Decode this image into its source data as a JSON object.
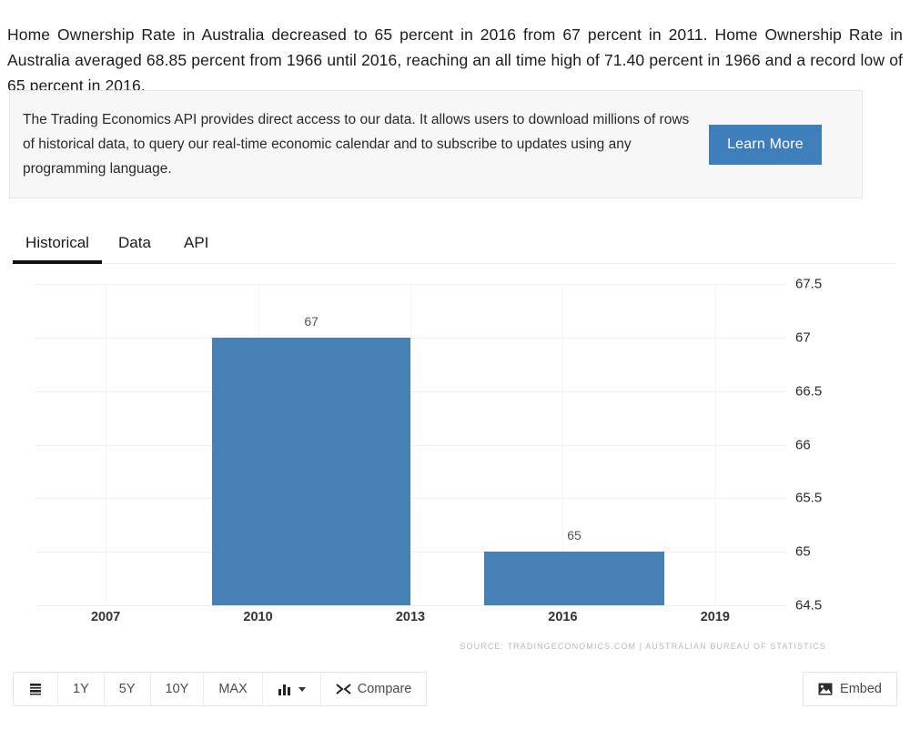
{
  "intro": {
    "text": "Home Ownership Rate in Australia decreased to 65 percent in 2016 from 67 percent in 2011. Home Ownership Rate in Australia averaged 68.85 percent from 1966 until 2016, reaching an all time high of 71.40 percent in 1966 and a record low of 65 percent in 2016."
  },
  "promo": {
    "text": "The Trading Economics API provides direct access to our data. It allows users to download millions of rows of historical data, to query our real-time economic calendar and to subscribe to updates using any programming language.",
    "button_label": "Learn More",
    "button_color": "#3d7ebb"
  },
  "tabs": [
    {
      "label": "Historical",
      "active": true
    },
    {
      "label": "Data",
      "active": false
    },
    {
      "label": "API",
      "active": false
    }
  ],
  "chart_data": {
    "type": "bar",
    "title": "",
    "xlabel": "",
    "ylabel": "",
    "categories": [
      "2011",
      "2016"
    ],
    "values": [
      67,
      65
    ],
    "data_labels": [
      "67",
      "65"
    ],
    "bar_color": "#4680b4",
    "bar_spans": [
      {
        "label": "67",
        "value": 67,
        "x_start": 2009.1,
        "x_end": 2013.0
      },
      {
        "label": "65",
        "value": 65,
        "x_start": 2014.45,
        "x_end": 2018.0
      }
    ],
    "xlim": [
      2005.6,
      2020.4
    ],
    "ylim": [
      64.5,
      67.5
    ],
    "yticks": [
      "67.5",
      "67",
      "66.5",
      "66",
      "65.5",
      "65",
      "64.5"
    ],
    "ytick_values": [
      67.5,
      67,
      66.5,
      66,
      65.5,
      65,
      64.5
    ],
    "xticks": [
      "2007",
      "2010",
      "2013",
      "2016",
      "2019"
    ],
    "xtick_values": [
      2007,
      2010,
      2013,
      2016,
      2019
    ],
    "grid": true,
    "legend": "none",
    "source": "SOURCE: TRADINGECONOMICS.COM  |  AUSTRALIAN BUREAU OF STATISTICS"
  },
  "toolbar": {
    "buttons": [
      {
        "name": "list-view",
        "label": "",
        "icon": "list-icon"
      },
      {
        "name": "range-1y",
        "label": "1Y",
        "icon": ""
      },
      {
        "name": "range-5y",
        "label": "5Y",
        "icon": ""
      },
      {
        "name": "range-10y",
        "label": "10Y",
        "icon": ""
      },
      {
        "name": "range-max",
        "label": "MAX",
        "icon": ""
      },
      {
        "name": "chart-type",
        "label": "",
        "icon": "bar-chart-icon"
      },
      {
        "name": "compare",
        "label": "Compare",
        "icon": "shuffle-icon"
      }
    ],
    "embed_label": "Embed"
  }
}
